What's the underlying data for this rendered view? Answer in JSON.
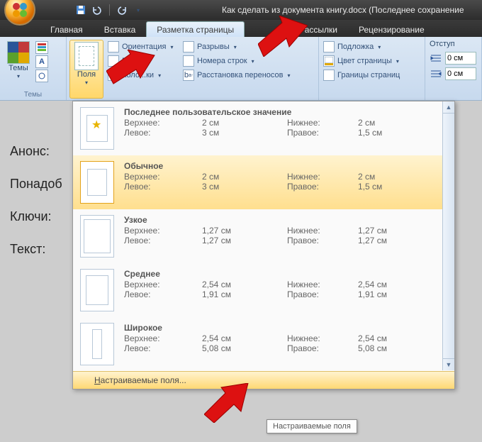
{
  "window": {
    "title": "Как сделать из документа книгу.docx (Последнее сохранение "
  },
  "tabs": {
    "home": "Главная",
    "insert": "Вставка",
    "page_layout": "Разметка страницы",
    "mailings": "Рассылки",
    "review": "Рецензирование"
  },
  "ribbon": {
    "themes_group": "Темы",
    "themes_btn": "Темы",
    "margins_btn": "Поля",
    "orientation": "Ориентация",
    "size": "Р...ер",
    "columns": "Коло...ки",
    "breaks": "Разрывы",
    "line_numbers": "Номера строк",
    "hyphenation": "Расстановка переносов",
    "watermark": "Подложка",
    "page_color": "Цвет страницы",
    "page_borders": "Границы страниц",
    "indent_label": "Отступ",
    "indent_left": "0 см",
    "indent_right": "0 см"
  },
  "gallery": {
    "items": [
      {
        "title": "Последнее пользовательское значение",
        "top_l": "Верхнее:",
        "top_v": "2 см",
        "bot_l": "Нижнее:",
        "bot_v": "2 см",
        "left_l": "Левое:",
        "left_v": "3 см",
        "right_l": "Правое:",
        "right_v": "1,5 см"
      },
      {
        "title": "Обычное",
        "top_l": "Верхнее:",
        "top_v": "2 см",
        "bot_l": "Нижнее:",
        "bot_v": "2 см",
        "left_l": "Левое:",
        "left_v": "3 см",
        "right_l": "Правое:",
        "right_v": "1,5 см"
      },
      {
        "title": "Узкое",
        "top_l": "Верхнее:",
        "top_v": "1,27 см",
        "bot_l": "Нижнее:",
        "bot_v": "1,27 см",
        "left_l": "Левое:",
        "left_v": "1,27 см",
        "right_l": "Правое:",
        "right_v": "1,27 см"
      },
      {
        "title": "Среднее",
        "top_l": "Верхнее:",
        "top_v": "2,54 см",
        "bot_l": "Нижнее:",
        "bot_v": "2,54 см",
        "left_l": "Левое:",
        "left_v": "1,91 см",
        "right_l": "Правое:",
        "right_v": "1,91 см"
      },
      {
        "title": "Широкое",
        "top_l": "Верхнее:",
        "top_v": "2,54 см",
        "bot_l": "Нижнее:",
        "bot_v": "2,54 см",
        "left_l": "Левое:",
        "left_v": "5,08 см",
        "right_l": "Правое:",
        "right_v": "5,08 см"
      }
    ],
    "custom_margins": "Настраиваемые поля...",
    "custom_margins_u": "Н"
  },
  "tooltip": "Настраиваемые поля",
  "doc": {
    "l1": "Анонс:",
    "l2": "Понадоб",
    "l3": "Ключи:",
    "l4": "Текст:"
  }
}
